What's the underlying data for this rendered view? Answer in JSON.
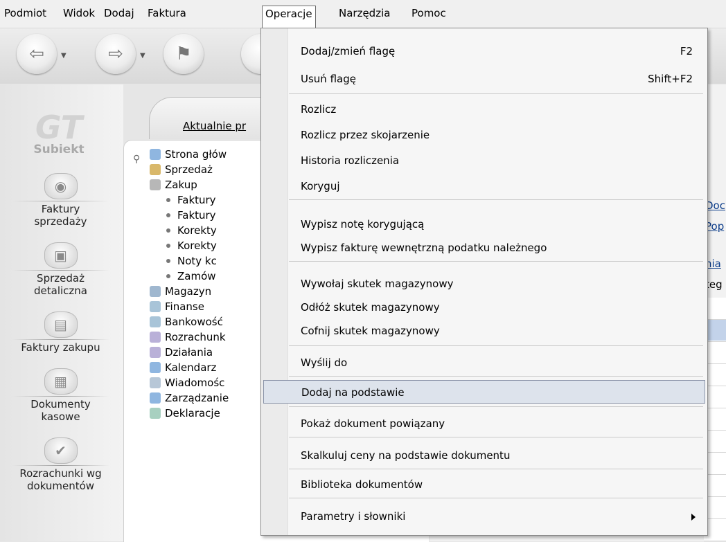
{
  "menubar": {
    "items": [
      "Podmiot",
      "Widok",
      "Dodaj",
      "Faktura",
      "Operacje",
      "Narzędzia",
      "Pomoc"
    ],
    "active": "Operacje"
  },
  "sidebar": {
    "logo": {
      "mark": "GT",
      "name": "Subiekt"
    },
    "modules": [
      {
        "label_1": "Faktury",
        "label_2": "sprzedaży"
      },
      {
        "label_1": "Sprzedaż",
        "label_2": "detaliczna"
      },
      {
        "label_1": "Faktury zakupu",
        "label_2": ""
      },
      {
        "label_1": "Dokumenty",
        "label_2": "kasowe"
      },
      {
        "label_1": "Rozrachunki wg",
        "label_2": "dokumentów"
      }
    ]
  },
  "main": {
    "tab_label": "Aktualnie pr",
    "nav": [
      {
        "label": "Strona głów",
        "level": 0
      },
      {
        "label": "Sprzedaż",
        "level": 0
      },
      {
        "label": "Zakup",
        "level": 0
      },
      {
        "label": "Faktury",
        "level": 1
      },
      {
        "label": "Faktury",
        "level": 1
      },
      {
        "label": "Korekty",
        "level": 1
      },
      {
        "label": "Korekty",
        "level": 1
      },
      {
        "label": "Noty kc",
        "level": 1
      },
      {
        "label": "Zamów",
        "level": 1
      },
      {
        "label": "Magazyn",
        "level": 0
      },
      {
        "label": "Finanse",
        "level": 0
      },
      {
        "label": "Bankowość",
        "level": 0
      },
      {
        "label": "Rozrachunk",
        "level": 0
      },
      {
        "label": "Działania",
        "level": 0
      },
      {
        "label": "Kalendarz",
        "level": 0
      },
      {
        "label": "Wiadomośc",
        "level": 0
      },
      {
        "label": "Zarządzanie",
        "level": 0
      },
      {
        "label": "Deklaracje",
        "level": 0
      }
    ]
  },
  "right": {
    "link_1": "Doc",
    "link_2": "Pop",
    "link_3": "nia",
    "text_1": "teg"
  },
  "dropdown": {
    "items": [
      {
        "label": "Dodaj/zmień flagę",
        "shortcut": "F2"
      },
      {
        "label": "Usuń flagę",
        "shortcut": "Shift+F2"
      },
      {
        "label": "Rozlicz",
        "shortcut": ""
      },
      {
        "label": "Rozlicz przez skojarzenie",
        "shortcut": ""
      },
      {
        "label": "Historia rozliczenia",
        "shortcut": ""
      },
      {
        "label": "Koryguj",
        "shortcut": ""
      },
      {
        "label": "Wypisz notę korygującą",
        "shortcut": ""
      },
      {
        "label": "Wypisz fakturę wewnętrzną podatku należnego",
        "shortcut": ""
      },
      {
        "label": "Wywołaj skutek magazynowy",
        "shortcut": ""
      },
      {
        "label": "Odłóż skutek magazynowy",
        "shortcut": ""
      },
      {
        "label": "Cofnij skutek magazynowy",
        "shortcut": ""
      },
      {
        "label": "Wyślij do",
        "shortcut": ""
      },
      {
        "label": "Dodaj na podstawie",
        "shortcut": ""
      },
      {
        "label": "Pokaż dokument powiązany",
        "shortcut": ""
      },
      {
        "label": "Skalkuluj ceny na podstawie dokumentu",
        "shortcut": ""
      },
      {
        "label": "Biblioteka dokumentów",
        "shortcut": ""
      },
      {
        "label": "Parametry i słowniki",
        "shortcut": ""
      }
    ],
    "highlighted": "Dodaj na podstawie"
  },
  "colors": {
    "menu_highlight": "#dde3ec",
    "menu_highlight_border": "#8a93a8",
    "link": "#0b3c8a"
  }
}
